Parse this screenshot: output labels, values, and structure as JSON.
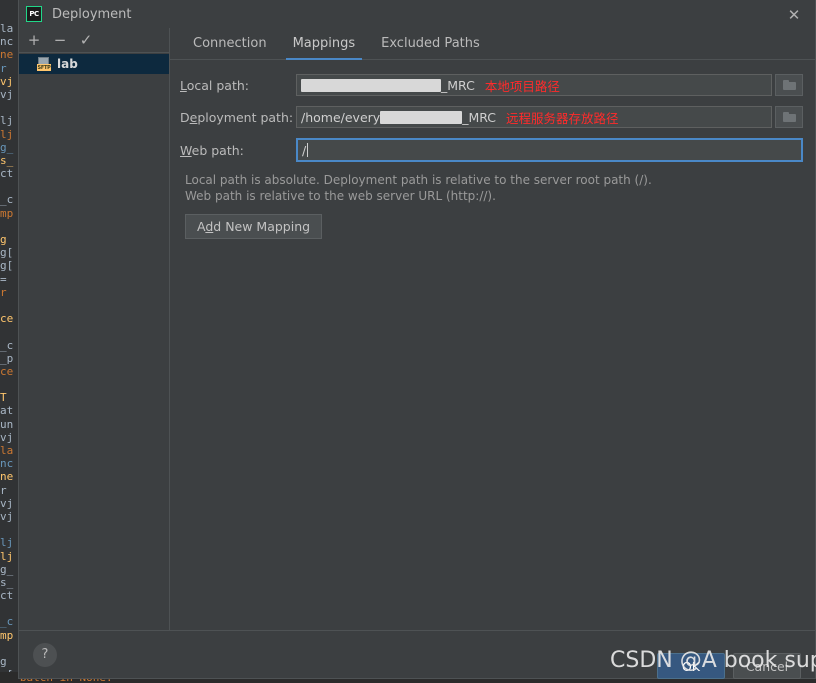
{
  "window": {
    "title": "Deployment",
    "app_icon": "pycharm-icon",
    "close_icon": "close-icon"
  },
  "left_pane": {
    "toolbar": [
      {
        "name": "add-server-button",
        "glyph": "+"
      },
      {
        "name": "remove-server-button",
        "glyph": "−"
      },
      {
        "name": "set-default-server-button",
        "glyph": "✓"
      }
    ],
    "servers": [
      {
        "label": "lab",
        "icon": "sftp-server-icon",
        "badge": "SFTP",
        "selected": true
      }
    ]
  },
  "tabs": [
    {
      "label": "Connection",
      "active": false
    },
    {
      "label": "Mappings",
      "active": true
    },
    {
      "label": "Excluded Paths",
      "active": false
    }
  ],
  "form": {
    "local_path": {
      "label_pre": "L",
      "label_mnemonic": "",
      "label": "Local path:",
      "value_redacted": true,
      "value_suffix": "_MRC",
      "annotation": "本地项目路径",
      "browse_icon": "folder-icon",
      "focused": false
    },
    "deployment_path": {
      "label": "Deployment path:",
      "value_prefix": "/home/every",
      "value_redacted": true,
      "value_suffix": "_MRC",
      "annotation": "远程服务器存放路径",
      "browse_icon": "folder-icon",
      "focused": false
    },
    "web_path": {
      "label": "Web path:",
      "value": "/",
      "annotation": "",
      "focused": true
    }
  },
  "hint": {
    "line1": "Local path is absolute. Deployment path is relative to the server root path (/).",
    "line2": "Web path is relative to the web server URL (http://)."
  },
  "add_mapping_button": {
    "text_before": "A",
    "mnemonic": "d",
    "text_after": "d New Mapping",
    "full_label": "Add New Mapping"
  },
  "footer": {
    "help_label": "?",
    "ok_label": "OK",
    "cancel_label": "Cancel"
  },
  "watermark": {
    "text": "CSDN @A book super"
  },
  "background": {
    "bottom_code": "   batch_in_None:",
    "gutter_fragments": [
      "la",
      "nc",
      "ne",
      "r",
      "vj",
      "vj",
      "",
      "lj",
      "lj",
      "g_",
      "s_",
      "ct",
      "",
      "_c",
      "mp",
      "",
      "g",
      "g[",
      "g[",
      "=",
      "r",
      "",
      "ce",
      "",
      "_c",
      "_p",
      "ce",
      "",
      "T",
      "at",
      "un",
      "vj"
    ]
  }
}
